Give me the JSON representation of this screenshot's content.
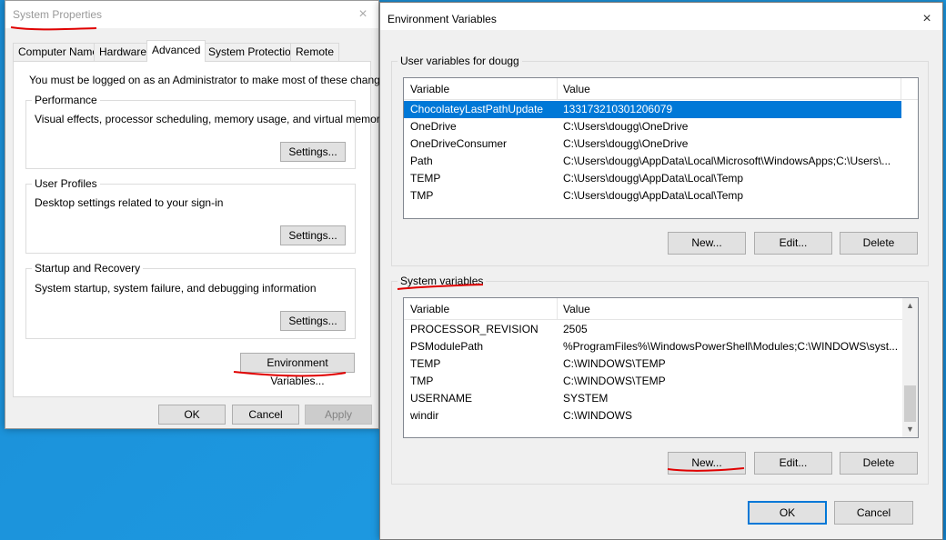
{
  "system_properties": {
    "title": "System Properties",
    "tabs": [
      "Computer Name",
      "Hardware",
      "Advanced",
      "System Protection",
      "Remote"
    ],
    "admin_note": "You must be logged on as an Administrator to make most of these changes.",
    "performance": {
      "label": "Performance",
      "description": "Visual effects, processor scheduling, memory usage, and virtual memory",
      "button": "Settings..."
    },
    "user_profiles": {
      "label": "User Profiles",
      "description": "Desktop settings related to your sign-in",
      "button": "Settings..."
    },
    "startup_recovery": {
      "label": "Startup and Recovery",
      "description": "System startup, system failure, and debugging information",
      "button": "Settings..."
    },
    "env_button": "Environment Variables...",
    "ok": "OK",
    "cancel": "Cancel",
    "apply": "Apply"
  },
  "env_vars": {
    "title": "Environment Variables",
    "user_group": "User variables for dougg",
    "system_group": "System variables",
    "col_variable": "Variable",
    "col_value": "Value",
    "user_rows": [
      {
        "name": "ChocolateyLastPathUpdate",
        "value": "133173210301206079"
      },
      {
        "name": "OneDrive",
        "value": "C:\\Users\\dougg\\OneDrive"
      },
      {
        "name": "OneDriveConsumer",
        "value": "C:\\Users\\dougg\\OneDrive"
      },
      {
        "name": "Path",
        "value": "C:\\Users\\dougg\\AppData\\Local\\Microsoft\\WindowsApps;C:\\Users\\..."
      },
      {
        "name": "TEMP",
        "value": "C:\\Users\\dougg\\AppData\\Local\\Temp"
      },
      {
        "name": "TMP",
        "value": "C:\\Users\\dougg\\AppData\\Local\\Temp"
      }
    ],
    "system_rows": [
      {
        "name": "PROCESSOR_REVISION",
        "value": "2505"
      },
      {
        "name": "PSModulePath",
        "value": "%ProgramFiles%\\WindowsPowerShell\\Modules;C:\\WINDOWS\\syst..."
      },
      {
        "name": "TEMP",
        "value": "C:\\WINDOWS\\TEMP"
      },
      {
        "name": "TMP",
        "value": "C:\\WINDOWS\\TEMP"
      },
      {
        "name": "USERNAME",
        "value": "SYSTEM"
      },
      {
        "name": "windir",
        "value": "C:\\WINDOWS"
      }
    ],
    "new": "New...",
    "edit": "Edit...",
    "delete": "Delete",
    "ok": "OK",
    "cancel": "Cancel"
  },
  "colors": {
    "selection": "#0078d7",
    "annotation": "#e00000",
    "desktop": "#1b8ed6"
  },
  "icons": {
    "close": "×",
    "scroll_up": "▲",
    "scroll_down": "▼"
  }
}
